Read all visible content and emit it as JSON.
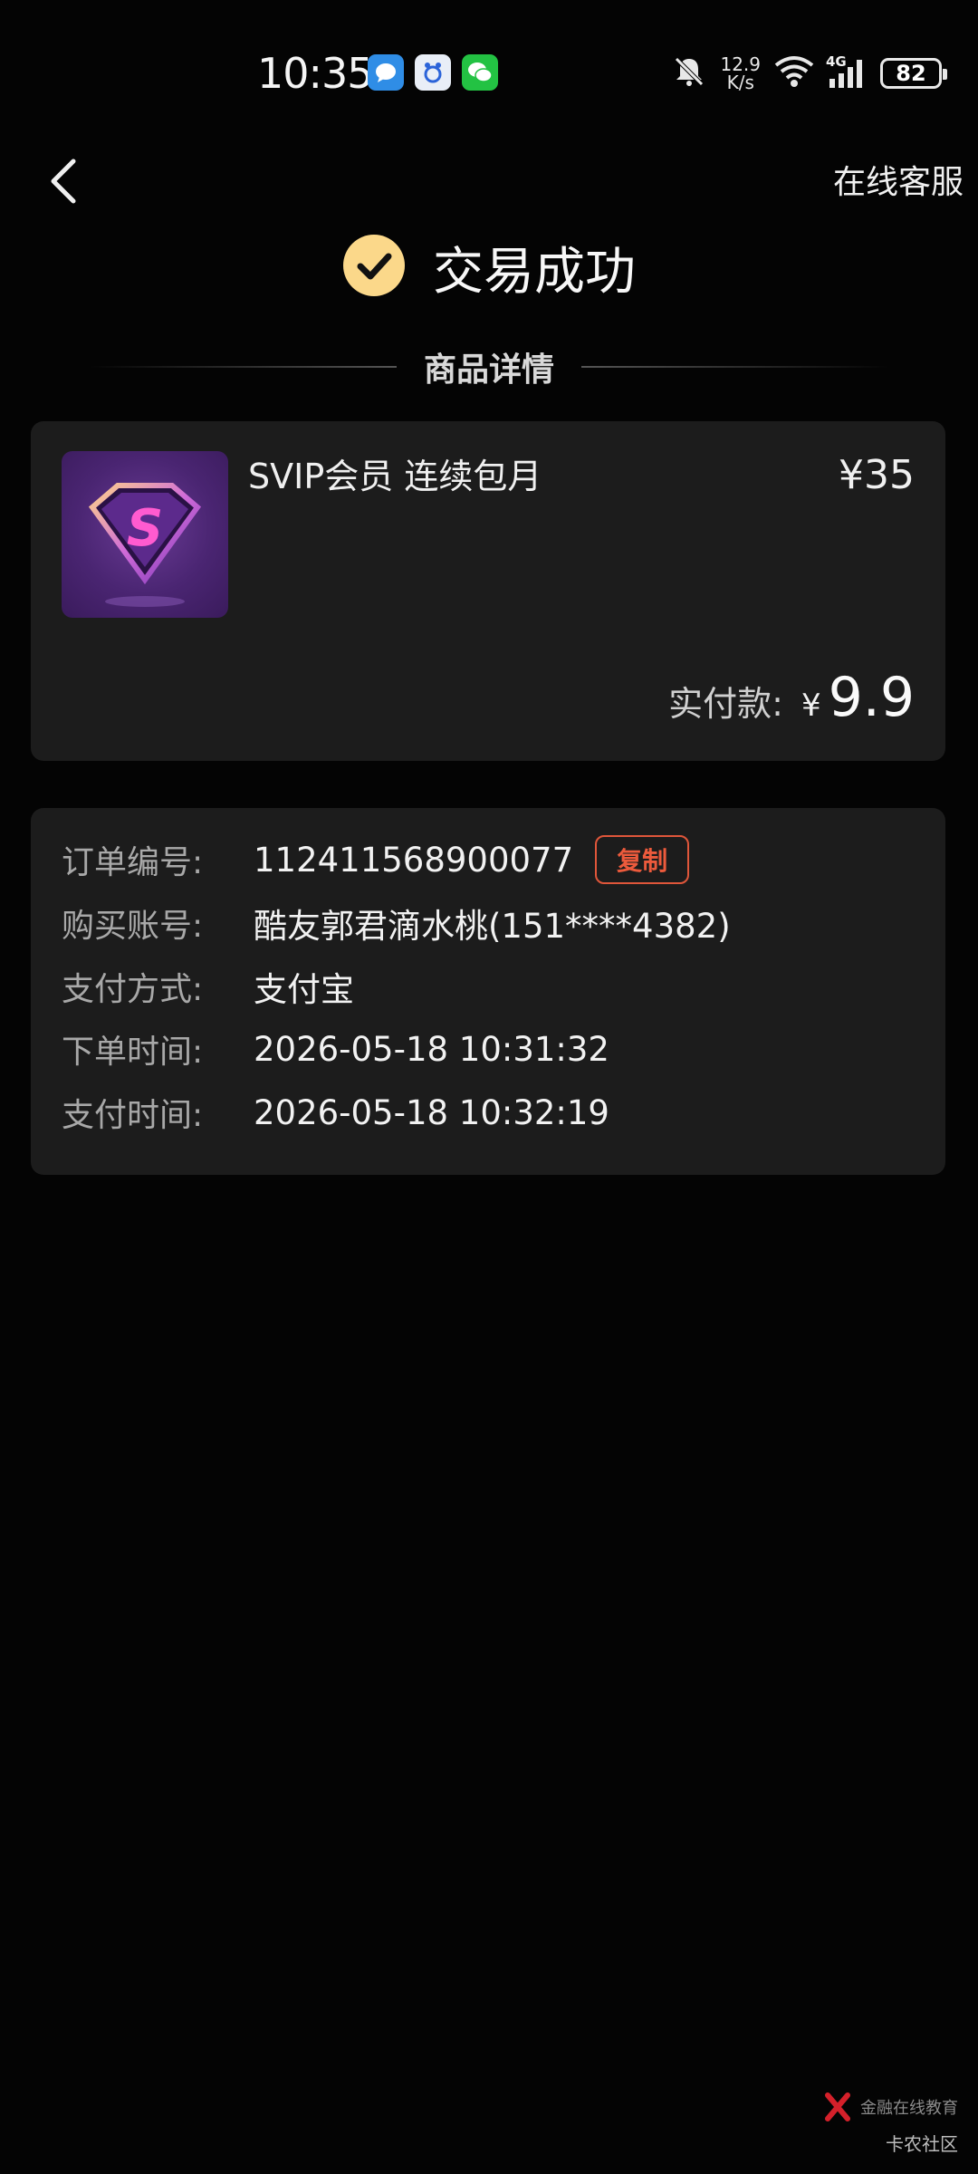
{
  "status_bar": {
    "time": "10:35",
    "net_speed_value": "12.9",
    "net_speed_unit": "K/s",
    "network_type": "4G",
    "battery": "82",
    "icons": [
      "messages-icon",
      "baidu-icon",
      "wechat-icon",
      "mute-bell-icon",
      "wifi-icon",
      "signal-icon"
    ]
  },
  "nav": {
    "back_icon": "chevron-left-icon",
    "customer_service": "在线客服"
  },
  "result": {
    "icon": "check-circle-icon",
    "title": "交易成功",
    "accent": "#fbd88a"
  },
  "section": {
    "title": "商品详情"
  },
  "product": {
    "name": "SVIP会员 连续包月",
    "price": "¥35",
    "paid_label": "实付款:",
    "paid_currency": "¥",
    "paid_amount": "9.9",
    "thumb_icon": "svip-diamond-icon"
  },
  "order": {
    "rows": [
      {
        "label": "订单编号:",
        "value": "112411568900077"
      },
      {
        "label": "购买账号:",
        "value": "酷友郭君滴水桃(151****4382)"
      },
      {
        "label": "支付方式:",
        "value": "支付宝"
      },
      {
        "label": "下单时间:",
        "value": "2026-05-18 10:31:32"
      },
      {
        "label": "支付时间:",
        "value": "2026-05-18 10:32:19"
      }
    ],
    "copy_label": "复制",
    "copy_color": "#e0563a"
  },
  "watermark": {
    "text": "金融在线教育",
    "site": "卡农社区"
  }
}
